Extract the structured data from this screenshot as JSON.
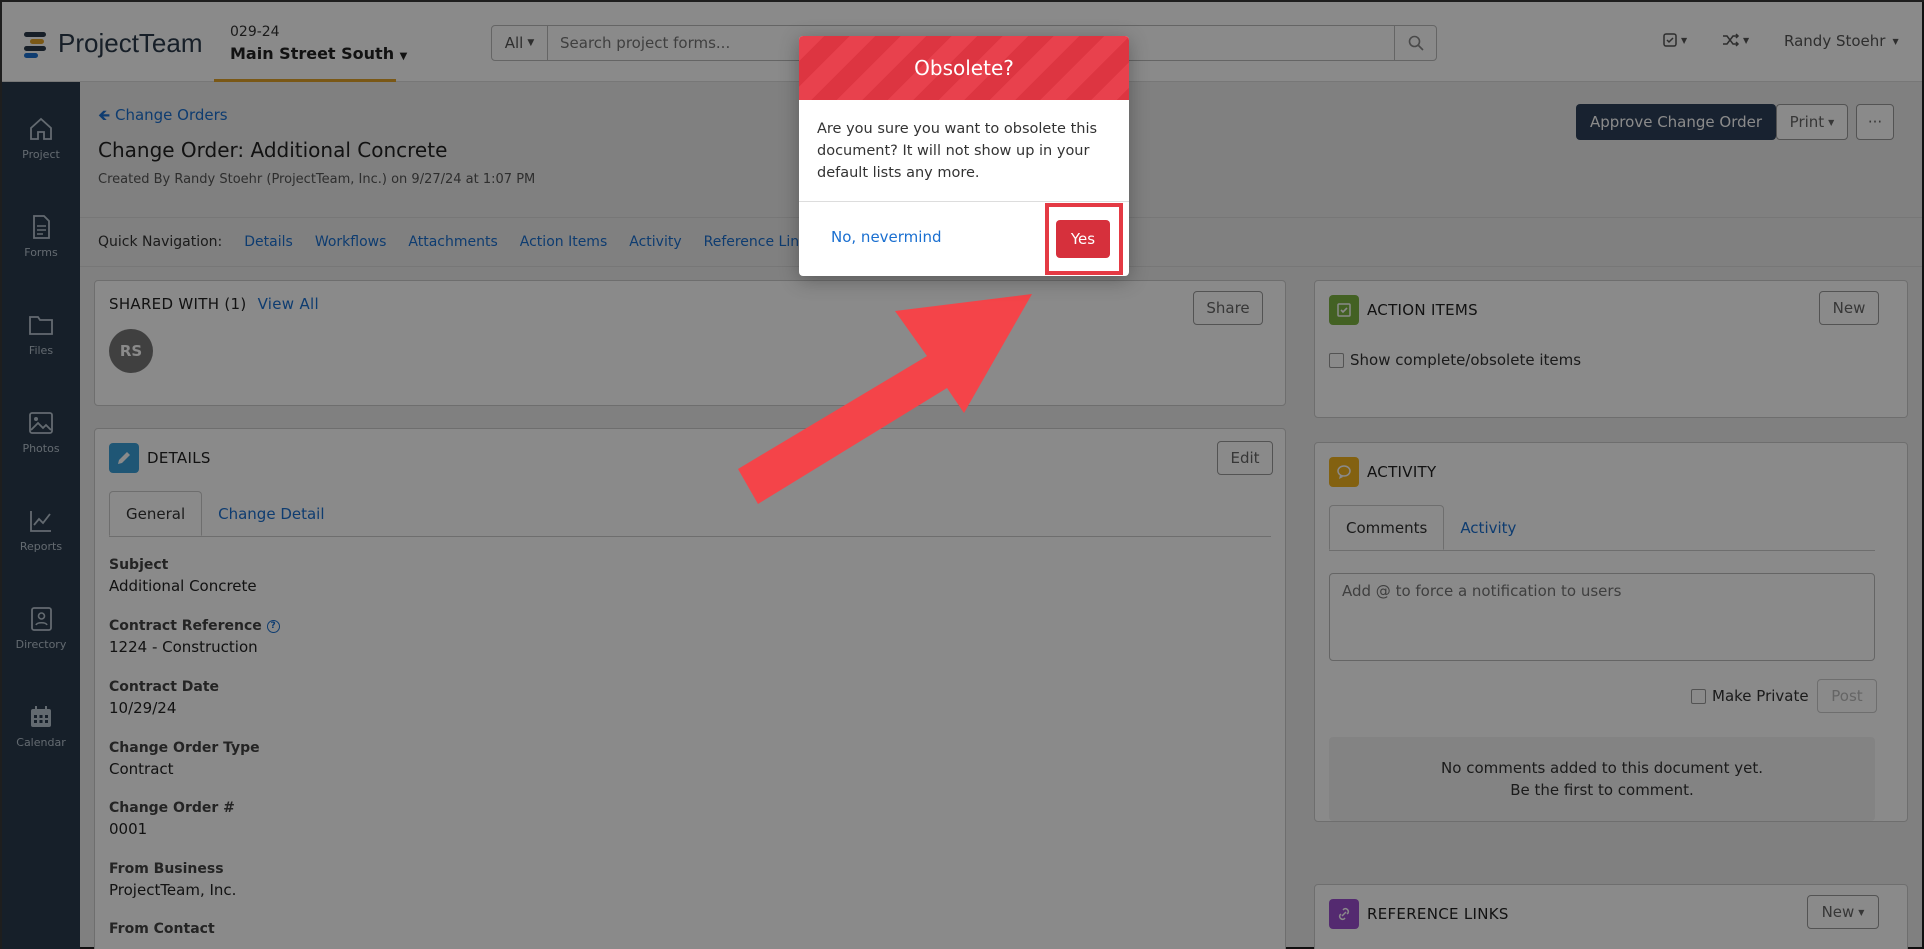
{
  "header": {
    "logo_text": "ProjectTeam",
    "project_number": "029-24",
    "project_name": "Main Street South",
    "search_scope": "All",
    "search_placeholder": "Search project forms...",
    "user_name": "Randy Stoehr"
  },
  "sidebar": {
    "items": [
      {
        "label": "Project",
        "icon": "home-icon"
      },
      {
        "label": "Forms",
        "icon": "document-icon"
      },
      {
        "label": "Files",
        "icon": "folder-icon"
      },
      {
        "label": "Photos",
        "icon": "image-icon"
      },
      {
        "label": "Reports",
        "icon": "chart-icon"
      },
      {
        "label": "Directory",
        "icon": "contact-icon"
      },
      {
        "label": "Calendar",
        "icon": "calendar-icon"
      }
    ]
  },
  "page": {
    "back_label": "Change Orders",
    "title": "Change Order: Additional Concrete",
    "created": "Created By Randy Stoehr (ProjectTeam, Inc.) on 9/27/24 at 1:07 PM",
    "approve_label": "Approve Change Order",
    "print_label": "Print",
    "more_label": "···"
  },
  "quick_nav": {
    "label": "Quick Navigation:",
    "links": [
      "Details",
      "Workflows",
      "Attachments",
      "Action Items",
      "Activity",
      "Reference Links"
    ]
  },
  "shared": {
    "title": "SHARED WITH (1)",
    "view_all": "View All",
    "share_label": "Share",
    "avatar_initials": "RS"
  },
  "details": {
    "title": "DETAILS",
    "edit_label": "Edit",
    "tabs": [
      "General",
      "Change Detail"
    ],
    "fields": [
      {
        "label": "Subject",
        "value": "Additional Concrete"
      },
      {
        "label": "Contract Reference",
        "value": "1224 - Construction"
      },
      {
        "label": "Contract Date",
        "value": "10/29/24"
      },
      {
        "label": "Change Order Type",
        "value": "Contract"
      },
      {
        "label": "Change Order #",
        "value": "0001"
      },
      {
        "label": "From Business",
        "value": "ProjectTeam, Inc."
      },
      {
        "label": "From Contact",
        "value": ""
      }
    ]
  },
  "action_items": {
    "title": "ACTION ITEMS",
    "new_label": "New",
    "show_complete": "Show complete/obsolete items"
  },
  "activity": {
    "title": "ACTIVITY",
    "tabs": [
      "Comments",
      "Activity"
    ],
    "comment_placeholder": "Add @ to force a notification to users",
    "make_private": "Make Private",
    "post_label": "Post",
    "empty_line1": "No comments added to this document yet.",
    "empty_line2": "Be the first to comment."
  },
  "reference_links": {
    "title": "REFERENCE LINKS",
    "new_label": "New"
  },
  "modal": {
    "title": "Obsolete?",
    "body": "Are you sure you want to obsolete this document? It will not show up in your default lists any more.",
    "cancel_label": "No, nevermind",
    "confirm_label": "Yes"
  },
  "colors": {
    "sidebar": "#2a3a4c",
    "link": "#1a6fd0",
    "accent_red": "#e43a44",
    "approve": "#2d4059"
  }
}
